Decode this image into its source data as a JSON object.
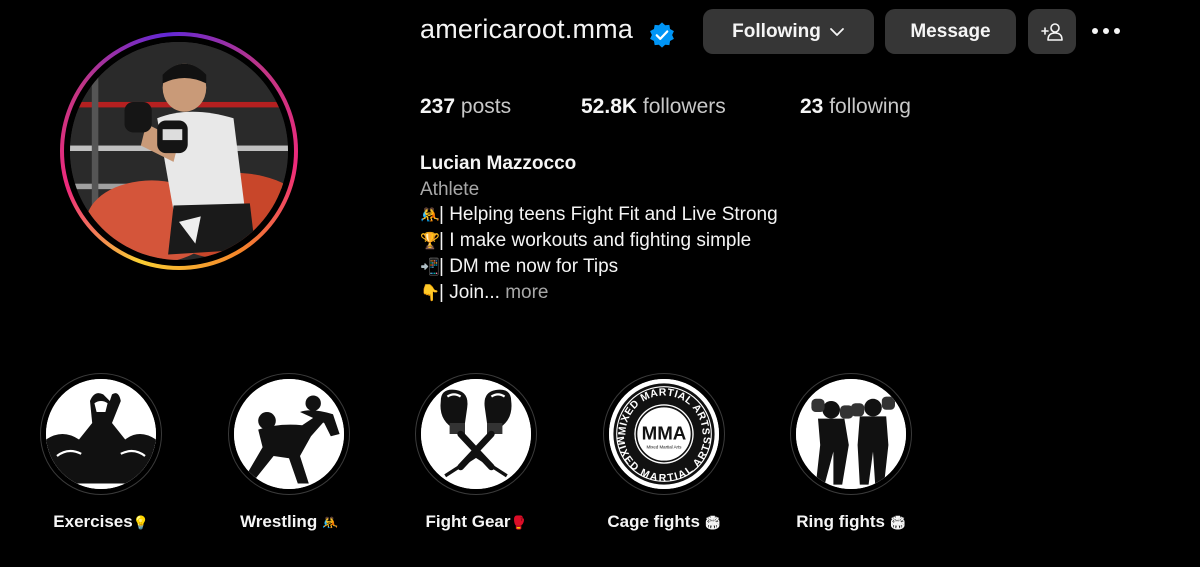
{
  "profile": {
    "username": "americaroot.mma",
    "verified": true,
    "buttons": {
      "following_label": "Following",
      "message_label": "Message"
    },
    "stats": {
      "posts_count": "237",
      "posts_label": "posts",
      "followers_count": "52.8K",
      "followers_label": "followers",
      "following_count": "23",
      "following_label": "following"
    },
    "bio": {
      "name": "Lucian Mazzocco",
      "category": "Athlete",
      "lines": [
        {
          "emoji": "🤼",
          "text": "| Helping teens Fight Fit and Live Strong"
        },
        {
          "emoji": "🏆",
          "text": "| I make workouts and fighting simple"
        },
        {
          "emoji": "📲",
          "text": "| DM me now for Tips"
        },
        {
          "emoji": "👇",
          "text": "| Join..."
        }
      ],
      "more_label": "more"
    }
  },
  "highlights": [
    {
      "label": "Exercises",
      "emoji": "💡",
      "icon": "arm-wrestling-icon"
    },
    {
      "label": "Wrestling ",
      "emoji": "🤼",
      "icon": "wrestlers-icon"
    },
    {
      "label": "Fight Gear",
      "emoji": "🥊",
      "icon": "boxing-gloves-icon"
    },
    {
      "label": "Cage fights ",
      "emoji": "🏟",
      "icon": "mma-badge-icon"
    },
    {
      "label": "Ring fights ",
      "emoji": "🏟",
      "icon": "boxers-icon"
    }
  ],
  "mma_badge": {
    "top_text": "MIXED MARTIAL ARTS",
    "bottom_text": "MIXED MARTIAL ARTS",
    "center_text": "MMA",
    "sub_text": "Mixed Martial Arts"
  },
  "colors": {
    "background": "#000000",
    "button": "#363636",
    "verified": "#0095f6",
    "muted_text": "#a8a8a8"
  }
}
